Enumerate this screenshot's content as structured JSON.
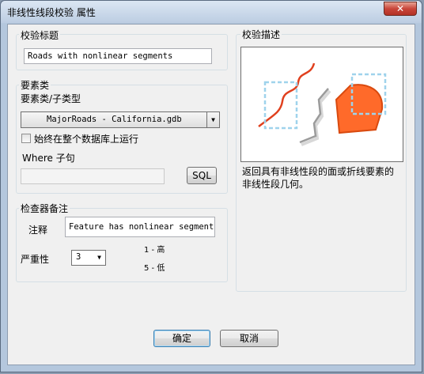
{
  "window": {
    "title": "非线性线段校验 属性",
    "close_glyph": "✕"
  },
  "check_title": {
    "group_label": "校验标题",
    "value": "Roads with nonlinear segments"
  },
  "feature_class": {
    "group_label": "要素类",
    "subtype_label": "要素类/子类型",
    "combo_value": "MajorRoads -  California.gdb",
    "checkbox_label": "始终在整个数据库上运行",
    "checkbox_checked": false,
    "where_label": "Where 子句",
    "where_value": "",
    "sql_button": "SQL"
  },
  "annotation": {
    "group_label": "检查器备注",
    "note_label": "注释",
    "note_value": "Feature has nonlinear segments",
    "severity_label": "严重性",
    "severity_value": "3",
    "legend_high": "1 - 高",
    "legend_low": "5 - 低"
  },
  "description": {
    "group_label": "校验描述",
    "text_line1": "返回具有非线性段的面或折线要素的",
    "text_line2": "非线性段几何。"
  },
  "footer": {
    "ok": "确定",
    "cancel": "取消"
  },
  "colors": {
    "highlight_orange": "#ff6a2a",
    "polygon_outline": "#d94a0f",
    "selection_box": "#9fd3ec",
    "gray_line": "#9b9b9b",
    "red_line": "#e0401e"
  }
}
